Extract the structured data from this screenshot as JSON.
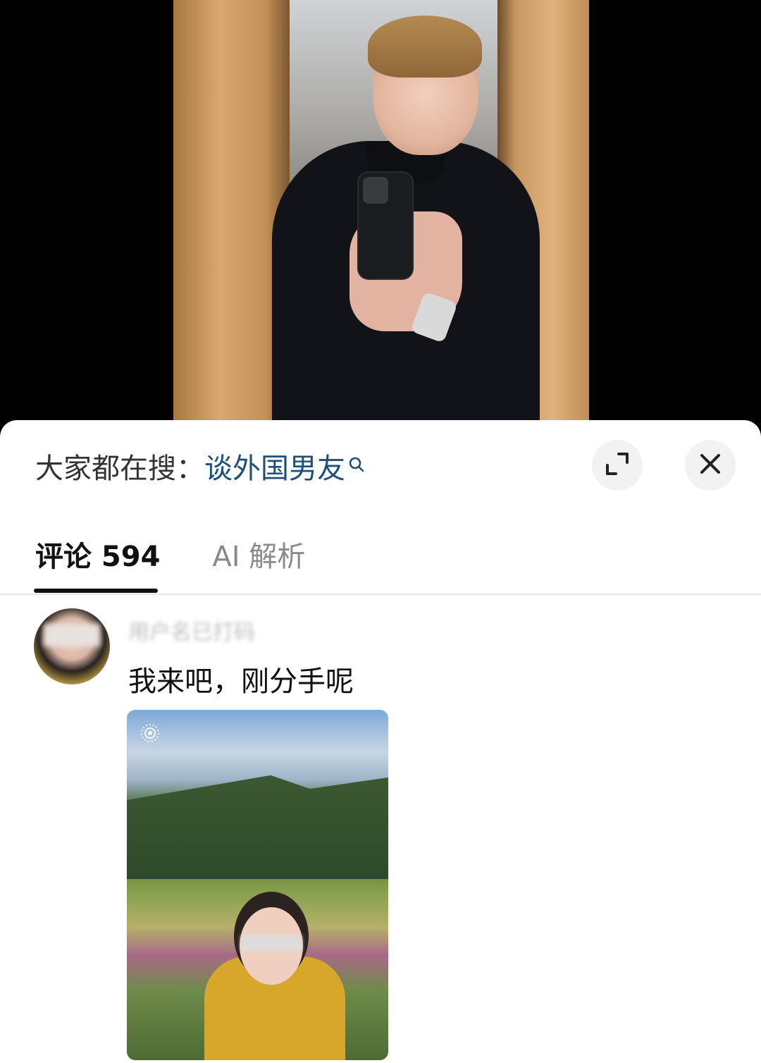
{
  "search_bar": {
    "prefix": "大家都在搜：",
    "term": "谈外国男友"
  },
  "tabs": {
    "comments": "评论 594",
    "ai": "AI 解析"
  },
  "comment": {
    "username": "用户名已打码",
    "text": "我来吧，刚分手呢"
  },
  "colors": {
    "accent_link": "#1f4e7a",
    "tab_active": "#111111",
    "tab_inactive": "#8a8a8a"
  },
  "icons": {
    "search": "search-icon",
    "expand": "expand-icon",
    "close": "close-icon",
    "live_photo": "live-photo-icon"
  }
}
